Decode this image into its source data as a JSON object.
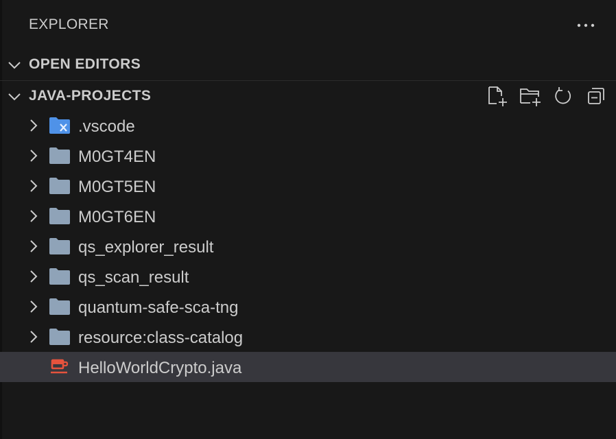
{
  "explorer": {
    "title": "EXPLORER",
    "more_icon": "ellipsis-icon"
  },
  "sections": {
    "open_editors": {
      "label": "OPEN EDITORS",
      "expanded": false
    },
    "project": {
      "label": "JAVA-PROJECTS",
      "expanded": true,
      "actions": [
        {
          "name": "new-file-icon"
        },
        {
          "name": "new-folder-icon"
        },
        {
          "name": "refresh-icon"
        },
        {
          "name": "collapse-all-icon"
        }
      ]
    }
  },
  "tree": {
    "items": [
      {
        "label": ".vscode",
        "type": "folder",
        "icon": "vscode-folder-icon",
        "expanded": false
      },
      {
        "label": "M0GT4EN",
        "type": "folder",
        "icon": "folder-icon",
        "expanded": false
      },
      {
        "label": "M0GT5EN",
        "type": "folder",
        "icon": "folder-icon",
        "expanded": false
      },
      {
        "label": "M0GT6EN",
        "type": "folder",
        "icon": "folder-icon",
        "expanded": false
      },
      {
        "label": "qs_explorer_result",
        "type": "folder",
        "icon": "folder-icon",
        "expanded": false
      },
      {
        "label": "qs_scan_result",
        "type": "folder",
        "icon": "folder-icon",
        "expanded": false
      },
      {
        "label": "quantum-safe-sca-tng",
        "type": "folder",
        "icon": "folder-icon",
        "expanded": false
      },
      {
        "label": "resource:class-catalog",
        "type": "folder",
        "icon": "folder-icon",
        "expanded": false
      },
      {
        "label": "HelloWorldCrypto.java",
        "type": "file",
        "icon": "java-file-icon",
        "selected": true
      }
    ]
  },
  "colors": {
    "background": "#181818",
    "selected_row": "#37373d",
    "folder": "#8fa3b8",
    "vscode_folder": "#4f92e8",
    "java_icon": "#e5533d",
    "text": "#cccccc"
  }
}
